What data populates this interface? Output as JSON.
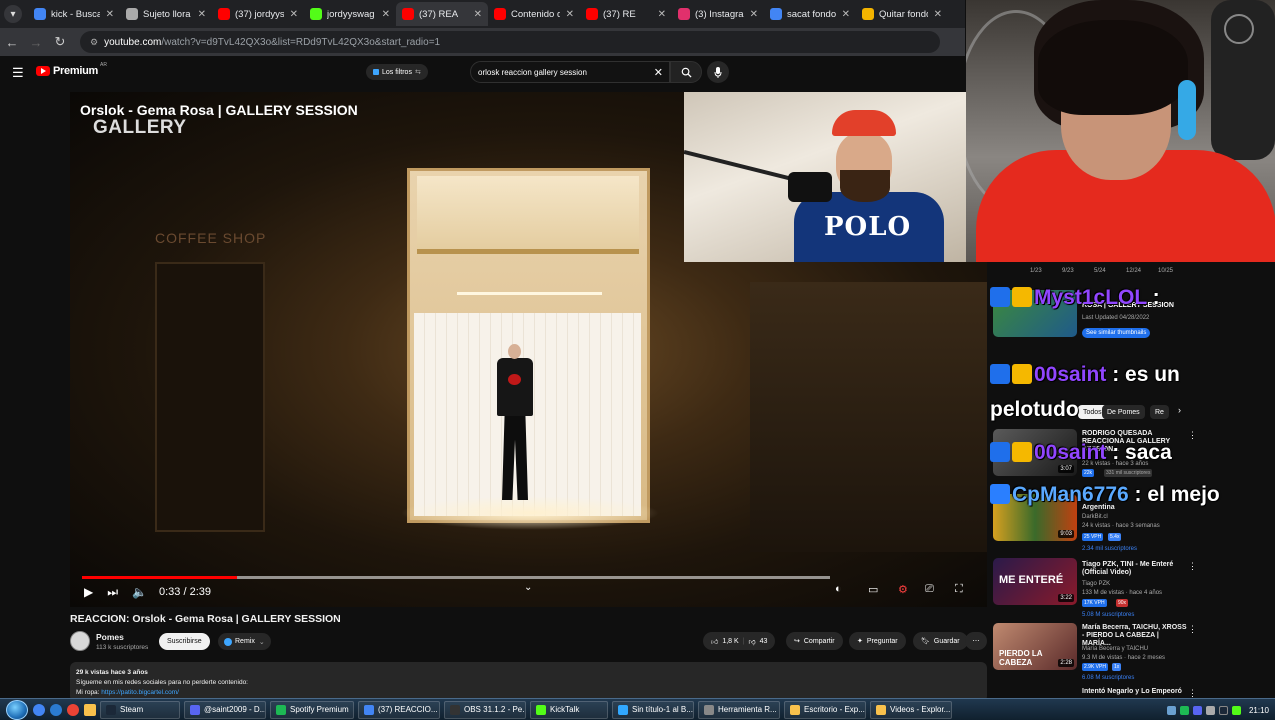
{
  "browser": {
    "tabs": [
      {
        "label": "kick - Buscar",
        "color": "#4285f4",
        "active": false
      },
      {
        "label": "Sujeto llora",
        "color": "#aaaaaa",
        "active": false
      },
      {
        "label": "(37) jordyys",
        "color": "#ff0000",
        "active": false
      },
      {
        "label": "jordyyswag",
        "color": "#53fc18",
        "active": false
      },
      {
        "label": "(37) REA",
        "color": "#ff0000",
        "active": true
      },
      {
        "label": "Contenido d",
        "color": "#ff0000",
        "active": false
      },
      {
        "label": "(37) RE",
        "color": "#ff0000",
        "active": false
      },
      {
        "label": "(3) Instagram",
        "color": "#e1306c",
        "active": false
      },
      {
        "label": "sacat fondo",
        "color": "#4285f4",
        "active": false
      },
      {
        "label": "Quitar fondo",
        "color": "#f4b400",
        "active": false
      }
    ],
    "url_host": "youtube.com",
    "url_rest": "/watch?v=d9TvL42QX3o&list=RDd9TvL42QX3o&start_radio=1"
  },
  "youtube": {
    "logo_word": "Premium",
    "logo_region": "AR",
    "filters_label": "Los filtros",
    "search_value": "orlosk reaccion gallery session"
  },
  "player": {
    "overlay_title": "Orslok - Gema Rosa | GALLERY SESSION",
    "overlay_sub": "GALLERY",
    "shop_sign": "COFFEE SHOP",
    "time": "0:33 / 2:39",
    "progress_fraction": 0.207
  },
  "video": {
    "title": "REACCION: Orslok - Gema Rosa | GALLERY SESSION",
    "channel": "Pomes",
    "subs": "113 k suscriptores",
    "subscribe_label": "Suscribirse",
    "remix_label": "Remix",
    "likes": "1,8 K",
    "dislikes": "43",
    "share": "Compartir",
    "ask": "Preguntar",
    "save": "Guardar",
    "desc_line1": "29 k vistas  hace 3 años",
    "desc_line2": "Sígueme en mis redes sociales para no perderte contenido:",
    "desc_line3_a": "Mi ropa: ",
    "desc_line3_link": "https://patito.bigcartel.com/"
  },
  "webcam": {
    "polo_text": "POLO"
  },
  "sidebar": {
    "dates": [
      "1/23",
      "9/23",
      "5/24",
      "12/24",
      "10/25"
    ],
    "card": {
      "title": "ROSA | GALLERY SESSION",
      "updated": "Last Updated 04/28/2022",
      "cta": "See similar thumbnails"
    },
    "chips": [
      {
        "label": "Todos",
        "on": true
      },
      {
        "label": "De Pomes",
        "on": false
      },
      {
        "label": "Re",
        "on": false
      }
    ],
    "videos": [
      {
        "title": "RODRIGO QUESADA REACCIONA AL GALLERY SESSION...",
        "channel": "DarkBit",
        "meta": "22 k vistas · hace 3 años",
        "dur": "3:07",
        "badge1": "22k",
        "badge2": "331 mil suscriptores"
      },
      {
        "title": "Argentina",
        "channel": "DarkBit.cl",
        "meta": "24 k vistas · hace 3 semanas",
        "dur": "9:03",
        "badge1": "25 VPH",
        "badge2": "5.4x",
        "subs": "2.34 mil suscriptores"
      },
      {
        "title": "Tiago PZK, TINI - Me Enteré (Official Video)",
        "channel": "Tiago PZK",
        "meta": "133 M de vistas · hace 4 años",
        "dur": "3:22",
        "badge1": "17K VPH",
        "badge2": "90x",
        "subs": "5.08 M suscriptores"
      },
      {
        "title": "María Becerra, TAICHU, XROSS - PIERDO LA CABEZA | MARÍA...",
        "channel": "María Becerra y TAICHU",
        "meta": "9.3 M de vistas · hace 2 meses",
        "dur": "2:28",
        "badge1": "2.9K VPH",
        "badge2": "1x",
        "subs": "6.08 M suscriptores"
      },
      {
        "title": "Intentó Negarlo y Lo Empeoró",
        "channel": "",
        "meta": "",
        "dur": "",
        "badge1": "",
        "badge2": ""
      }
    ]
  },
  "chat": [
    {
      "user": "Myst1cLOL",
      "message": " :",
      "user_color": "#9146ff"
    },
    {
      "user": "00saint",
      "message": " : es un",
      "user_color": "#9146ff"
    },
    {
      "user": "",
      "message": "pelotudo",
      "user_color": "#9146ff"
    },
    {
      "user": "00saint",
      "message": " : saca",
      "user_color": "#9146ff"
    },
    {
      "user": "CpMan6776",
      "message": " : el mejo",
      "user_color": "#5aa9ff"
    }
  ],
  "taskbar": {
    "items": [
      {
        "label": "Steam",
        "color": "#1b2838"
      },
      {
        "label": "@saint2009 - D...",
        "color": "#5865f2"
      },
      {
        "label": "Spotify Premium",
        "color": "#1db954"
      },
      {
        "label": "(37) REACCIO...",
        "color": "#4285f4"
      },
      {
        "label": "OBS 31.1.2 - Pe...",
        "color": "#333333"
      },
      {
        "label": "KickTalk",
        "color": "#53fc18"
      },
      {
        "label": "Sin título-1 al B...",
        "color": "#31a8ff"
      },
      {
        "label": "Herramienta R...",
        "color": "#888888"
      },
      {
        "label": "Escritorio - Exp...",
        "color": "#f8c14c"
      },
      {
        "label": "Videos - Explor...",
        "color": "#f8c14c"
      }
    ],
    "clock": "21:10"
  }
}
